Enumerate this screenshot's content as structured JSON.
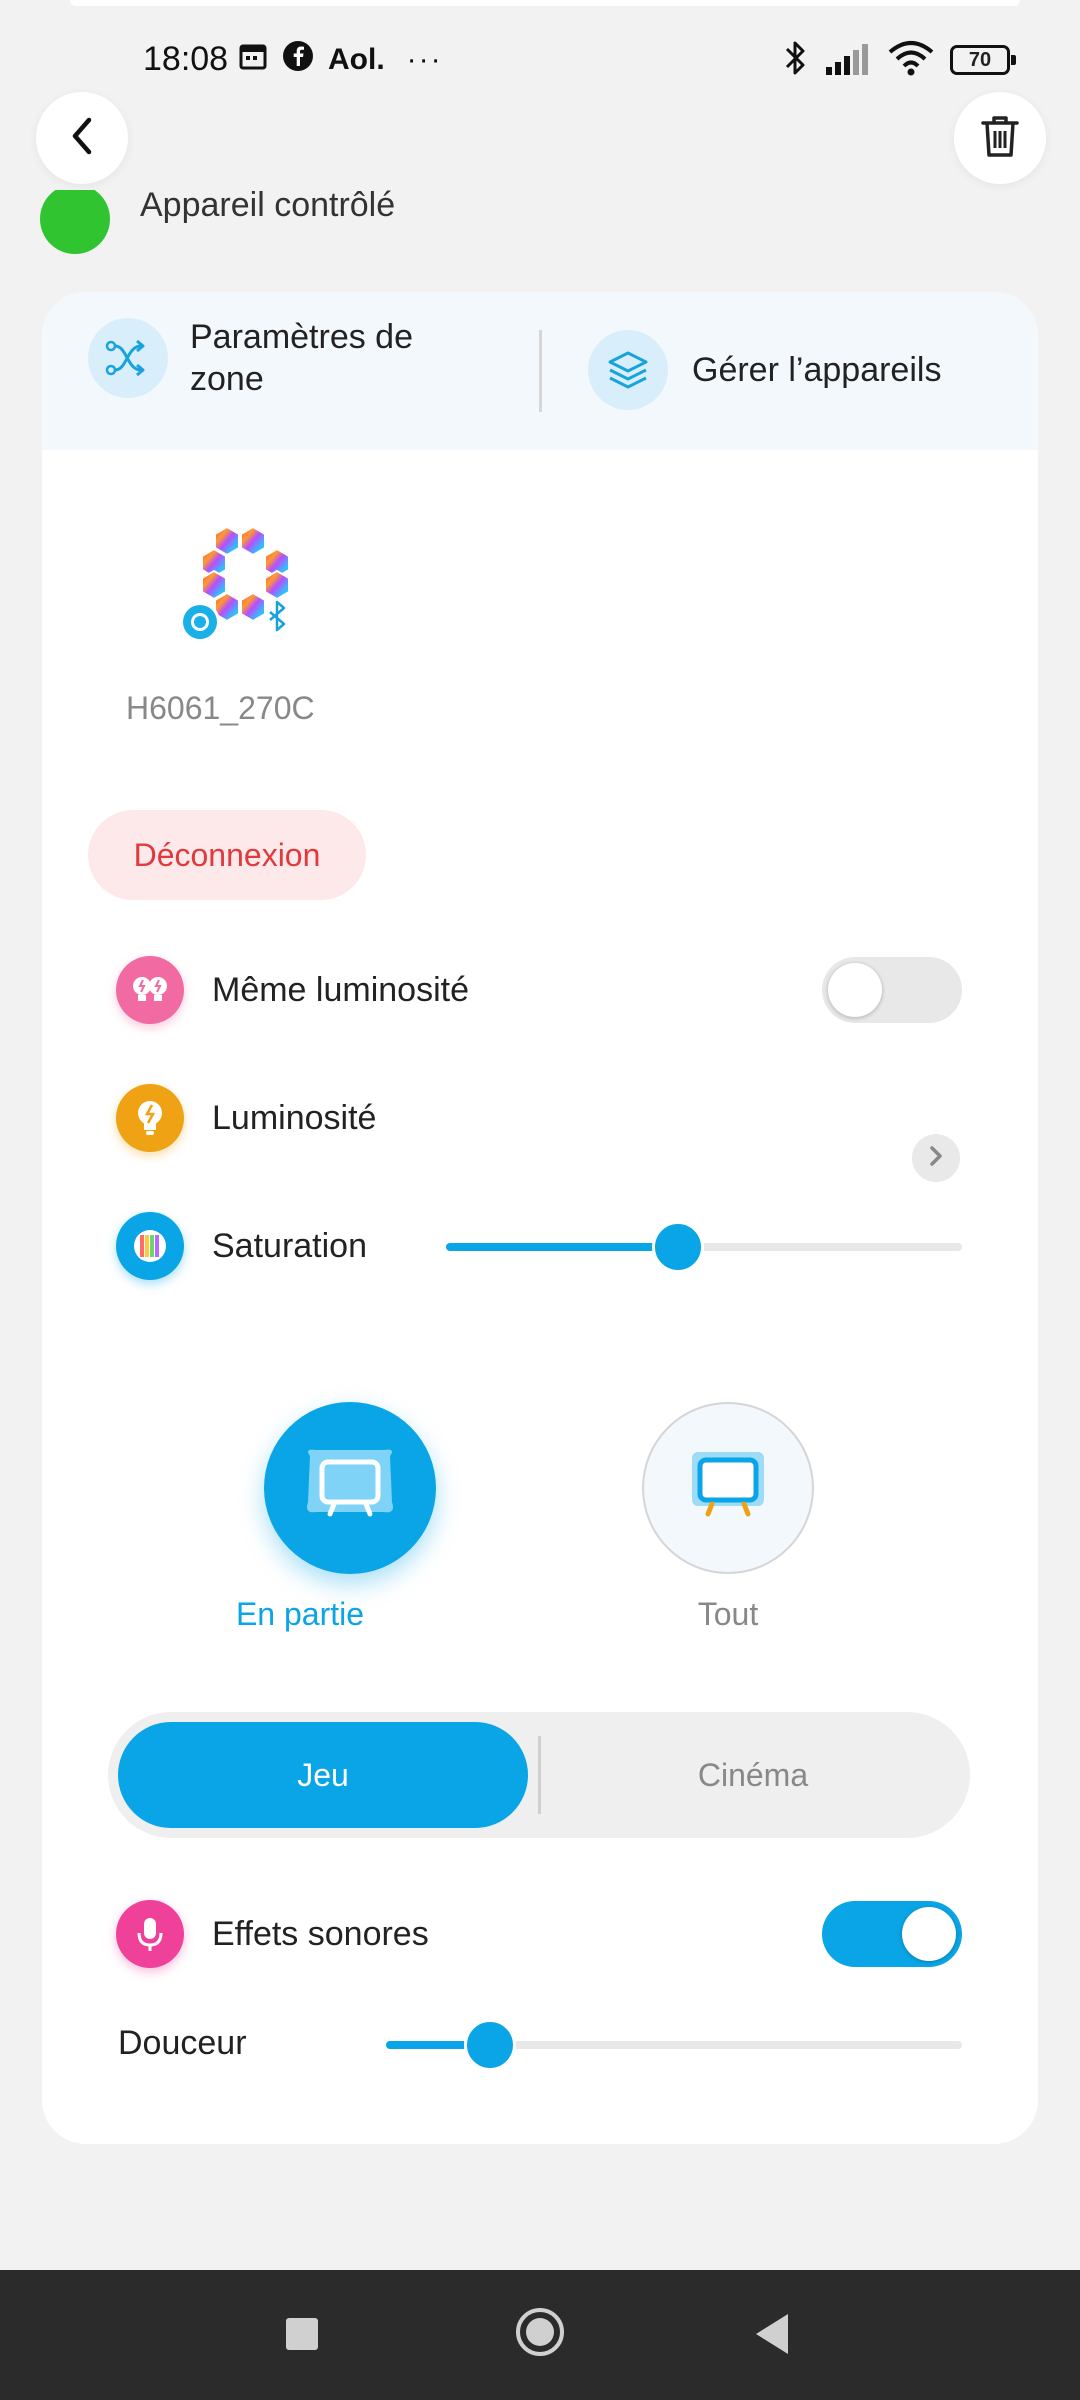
{
  "status_bar": {
    "time": "18:08",
    "left_icons": [
      "calendar-icon",
      "facebook-icon"
    ],
    "carrier_text": "Aol.",
    "more_text": "···",
    "battery": "70"
  },
  "header": {
    "back_icon": "chevron-left-icon",
    "delete_icon": "trash-icon"
  },
  "partial_row": {
    "label": "Appareil contrôlé"
  },
  "zone": {
    "settings_label": "Paramètres de zone",
    "manage_label": "Gérer l’appareils"
  },
  "device": {
    "name": "H6061_270C",
    "badges": [
      "alexa-icon",
      "bluetooth-icon"
    ]
  },
  "disconnect_label": "Déconnexion",
  "settings": {
    "same_brightness": {
      "label": "Même luminosité",
      "on": false
    },
    "brightness": {
      "label": "Luminosité"
    },
    "saturation": {
      "label": "Saturation",
      "value_fraction": 0.45
    }
  },
  "modes": [
    {
      "label": "En partie",
      "active": true
    },
    {
      "label": "Tout",
      "active": false
    }
  ],
  "segmented": {
    "options": [
      "Jeu",
      "Cinéma"
    ],
    "selected": "Jeu"
  },
  "sound_effects": {
    "label": "Effets sonores",
    "on": true
  },
  "smoothness": {
    "label": "Douceur",
    "value_fraction": 0.18
  },
  "colors": {
    "accent": "#0aa5e6",
    "danger": "#e0393e",
    "brightness_same_icon_bg": "#f26aa2",
    "brightness_icon_bg": "#f0a215",
    "saturation_icon_bg": "#0aa5e6",
    "sound_icon_bg": "#f0419a"
  }
}
